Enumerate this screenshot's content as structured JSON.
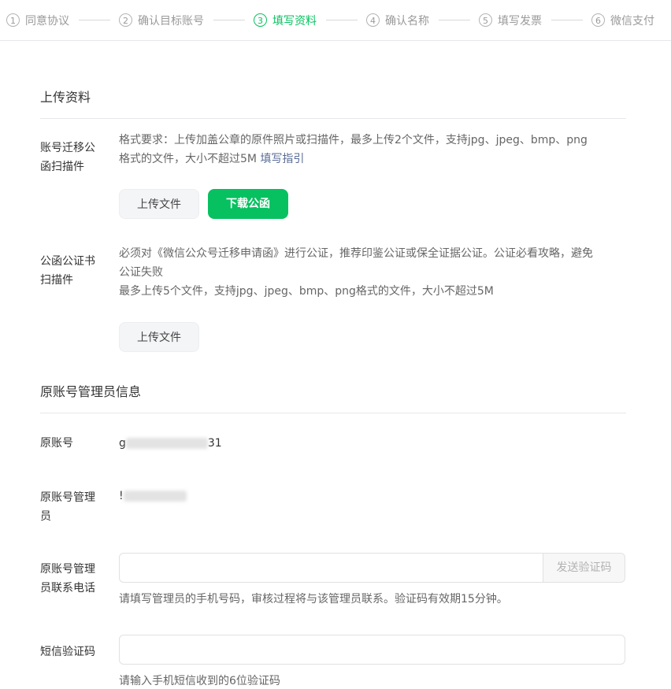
{
  "steps": [
    {
      "num": "1",
      "label": "同意协议"
    },
    {
      "num": "2",
      "label": "确认目标账号"
    },
    {
      "num": "3",
      "label": "填写资料"
    },
    {
      "num": "4",
      "label": "确认名称"
    },
    {
      "num": "5",
      "label": "填写发票"
    },
    {
      "num": "6",
      "label": "微信支付"
    }
  ],
  "upload_section": {
    "title": "上传资料",
    "letter": {
      "label_line1": "账号迁移公",
      "label_line2": "函扫描件",
      "desc_line1": "格式要求：上传加盖公章的原件照片或扫描件，最多上传2个文件，支持jpg、jpeg、bmp、png",
      "desc_line2": "格式的文件，大小不超过5M ",
      "guide_link": "填写指引",
      "upload_button": "上传文件",
      "download_button": "下载公函"
    },
    "notary": {
      "label_line1": "公函公证书",
      "label_line2": "扫描件",
      "desc_line1": "必须对《微信公众号迁移申请函》进行公证，推荐印鉴公证或保全证据公证。公证必看攻略，避免",
      "desc_line2": "公证失败",
      "desc_line3": "最多上传5个文件，支持jpg、jpeg、bmp、png格式的文件，大小不超过5M",
      "upload_button": "上传文件"
    }
  },
  "admin_section": {
    "title": "原账号管理员信息",
    "account": {
      "label": "原账号",
      "value_prefix": "g",
      "value_suffix": "31"
    },
    "admin": {
      "label_line1": "原账号管理",
      "label_line2": "员",
      "value_prefix": "!"
    },
    "phone": {
      "label_line1": "原账号管理",
      "label_line2": "员联系电话",
      "input_value": "",
      "send_code_button": "发送验证码",
      "hint": "请填写管理员的手机号码，审核过程将与该管理员联系。验证码有效期15分钟。"
    },
    "sms": {
      "label": "短信验证码",
      "input_value": "",
      "hint": "请输入手机短信收到的6位验证码"
    }
  },
  "colors": {
    "accent": "#07c160",
    "link": "#576b95",
    "text": "#333333",
    "muted": "#666666"
  }
}
